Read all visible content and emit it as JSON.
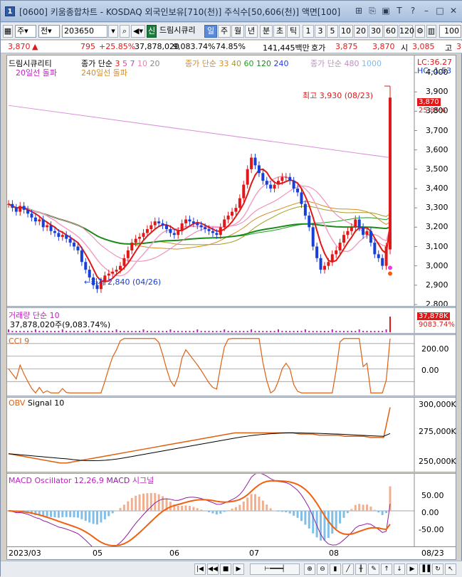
{
  "window": {
    "title": "[0600] 키움종합차트 - KOSDAQ 외국인보유[710(천)] 주식수[50,606(천)] 액면[100]",
    "app_icon": "1"
  },
  "toolbar": {
    "market_select": "주",
    "type_select": "전",
    "code": "203650",
    "company": "드림시큐리",
    "period_buttons": [
      "일",
      "주",
      "월",
      "년",
      "분",
      "초",
      "틱"
    ],
    "selected_period": "일",
    "interval_buttons": [
      "1",
      "3",
      "5",
      "10",
      "20",
      "30",
      "60",
      "120"
    ],
    "count": "100",
    "new_label": "신"
  },
  "quote": {
    "price": "3,870",
    "arrow": "▲",
    "change": "795",
    "rate": "+25.85%",
    "volume": "37,878,020",
    "vol_ratio": "9,083.74%",
    "turnover": "74.85%",
    "amount": "141,445백만",
    "hoga_label": "호가",
    "ask": "3,875",
    "bid": "3,870",
    "open_label": "시",
    "open": "3,085",
    "high_label": "고",
    "high_trunc": "3"
  },
  "price_pane": {
    "stock_name": "드림시큐리티",
    "ma_legend_1": "종가 단순",
    "ma_periods_1": [
      "3",
      "5",
      "7",
      "10",
      "20"
    ],
    "ma_legend_2": "종가 단순",
    "ma_periods_2": [
      "33",
      "40",
      "60",
      "120",
      "240"
    ],
    "ma_legend_3": "종가 단순",
    "ma_periods_3": [
      "480",
      "1000"
    ],
    "break_20": "20일선 돌파",
    "break_240": "240일선 돌파",
    "lc": "LC:36.27",
    "hc": "HC:-1.53",
    "high_note": "최고 3,930 (08/23)",
    "low_note": "최저 2,840 (04/26)",
    "last_price_tag": "3,870",
    "last_rate_tag": "25.85%",
    "y_ticks": [
      "4,000",
      "3,900",
      "3,800",
      "3,700",
      "3,600",
      "3,500",
      "3,400",
      "3,300",
      "3,200",
      "3,100",
      "3,000",
      "2,900",
      "2,800"
    ]
  },
  "volume_pane": {
    "title": "거래량 단순 10",
    "value": "37,878,020주(9,083.74%)",
    "tag_volume": "37,878K",
    "tag_ratio": "9083.74%"
  },
  "cci_pane": {
    "title": "CCI 9",
    "y_ticks": [
      "200.00",
      "0.00"
    ]
  },
  "obv_pane": {
    "title_obv": "OBV",
    "title_signal": "Signal 10",
    "y_ticks": [
      "300,000K",
      "275,000K",
      "250,000K"
    ]
  },
  "macd_pane": {
    "title_osc": "MACD Oscillator 12,26,9",
    "title_macd": "MACD",
    "title_signal": "시그널",
    "y_ticks": [
      "50.00",
      "0.00",
      "-50.00"
    ]
  },
  "x_axis": {
    "labels": [
      "2023/03",
      "05",
      "06",
      "07",
      "08"
    ],
    "right_label": "08/23"
  },
  "chart_data": {
    "type": "candlestick",
    "x_labels": [
      "2023/03",
      "05",
      "06",
      "07",
      "08"
    ],
    "y_range": [
      2800,
      4000
    ],
    "high": {
      "value": 3930,
      "date": "08/23"
    },
    "low": {
      "value": 2840,
      "date": "04/26"
    },
    "last_close": 3870,
    "close_series": [
      3320,
      3300,
      3280,
      3310,
      3290,
      3270,
      3250,
      3230,
      3240,
      3200,
      3210,
      3180,
      3170,
      3150,
      3160,
      3140,
      3120,
      3100,
      3080,
      3020,
      2980,
      2940,
      2900,
      2880,
      2920,
      2950,
      2960,
      2970,
      2980,
      3000,
      3040,
      3080,
      3120,
      3140,
      3150,
      3170,
      3190,
      3210,
      3230,
      3220,
      3210,
      3190,
      3170,
      3160,
      3180,
      3220,
      3240,
      3230,
      3220,
      3210,
      3200,
      3190,
      3180,
      3170,
      3160,
      3200,
      3240,
      3260,
      3280,
      3300,
      3350,
      3420,
      3500,
      3560,
      3520,
      3480,
      3440,
      3420,
      3400,
      3420,
      3440,
      3460,
      3460,
      3440,
      3400,
      3380,
      3320,
      3260,
      3200,
      3100,
      3040,
      2980,
      3000,
      3020,
      3060,
      3080,
      3120,
      3160,
      3180,
      3200,
      3240,
      3200,
      3160,
      3180,
      3120,
      3060,
      3040,
      3000,
      3100,
      3870
    ],
    "moving_averages": [
      {
        "name": "5",
        "color": "#e01818"
      },
      {
        "name": "10",
        "color": "#f0a0c8"
      },
      {
        "name": "20",
        "color": "#f080b0"
      },
      {
        "name": "60",
        "color": "#20a020"
      },
      {
        "name": "120",
        "color": "#1c8a1c"
      },
      {
        "name": "240",
        "color": "#2838e8"
      },
      {
        "name": "480",
        "color": "#d890d8"
      }
    ],
    "obv_series": [
      258,
      257,
      256,
      255,
      254,
      253,
      252,
      251,
      250,
      250,
      251,
      252,
      253,
      254,
      255,
      256,
      257,
      258,
      259,
      260,
      261,
      262,
      263,
      264,
      265,
      266,
      267,
      268,
      269,
      270,
      271,
      272,
      273,
      274,
      275,
      276,
      276,
      276,
      276,
      276,
      276,
      276,
      276,
      276,
      276,
      275,
      275,
      275,
      274,
      274,
      274,
      274,
      273,
      273,
      273,
      273,
      272,
      272,
      272,
      298
    ],
    "cci_range": [
      -200,
      250
    ],
    "macd_range": [
      -80,
      80
    ]
  }
}
